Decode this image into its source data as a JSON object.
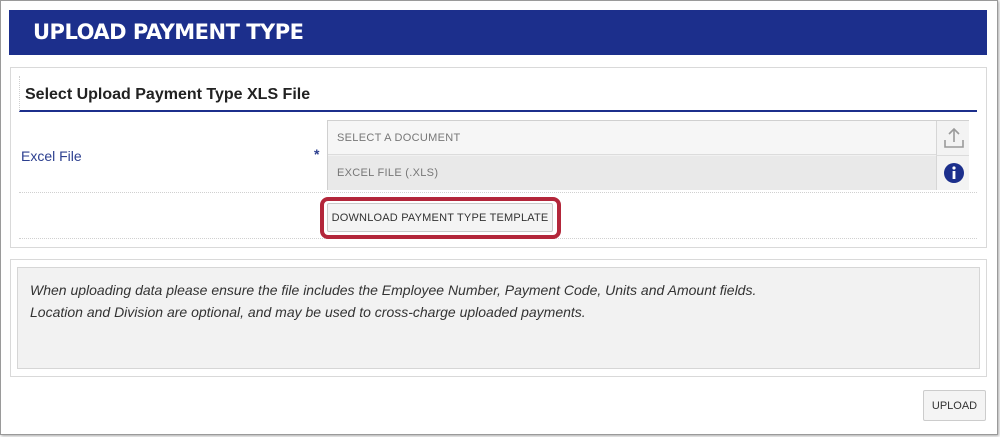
{
  "header": {
    "title": "UPLOAD PAYMENT TYPE"
  },
  "section": {
    "title": "Select Upload Payment Type XLS File"
  },
  "excel_field": {
    "label": "Excel File",
    "required_marker": "*",
    "document_placeholder": "SELECT A DOCUMENT",
    "file_type_hint": "EXCEL FILE (.XLS)",
    "upload_icon": "upload-icon",
    "info_icon": "info-icon"
  },
  "download_template_label": "DOWNLOAD PAYMENT TYPE TEMPLATE",
  "info": {
    "line1": "When uploading data please ensure the file includes the Employee Number, Payment Code, Units and Amount fields.",
    "line2": "Location and Division are optional, and may be used to cross-charge uploaded payments."
  },
  "upload_label": "UPLOAD",
  "colors": {
    "header_bg": "#1c2f8c",
    "highlight": "#b3263a",
    "label_blue": "#2c3f8f"
  }
}
